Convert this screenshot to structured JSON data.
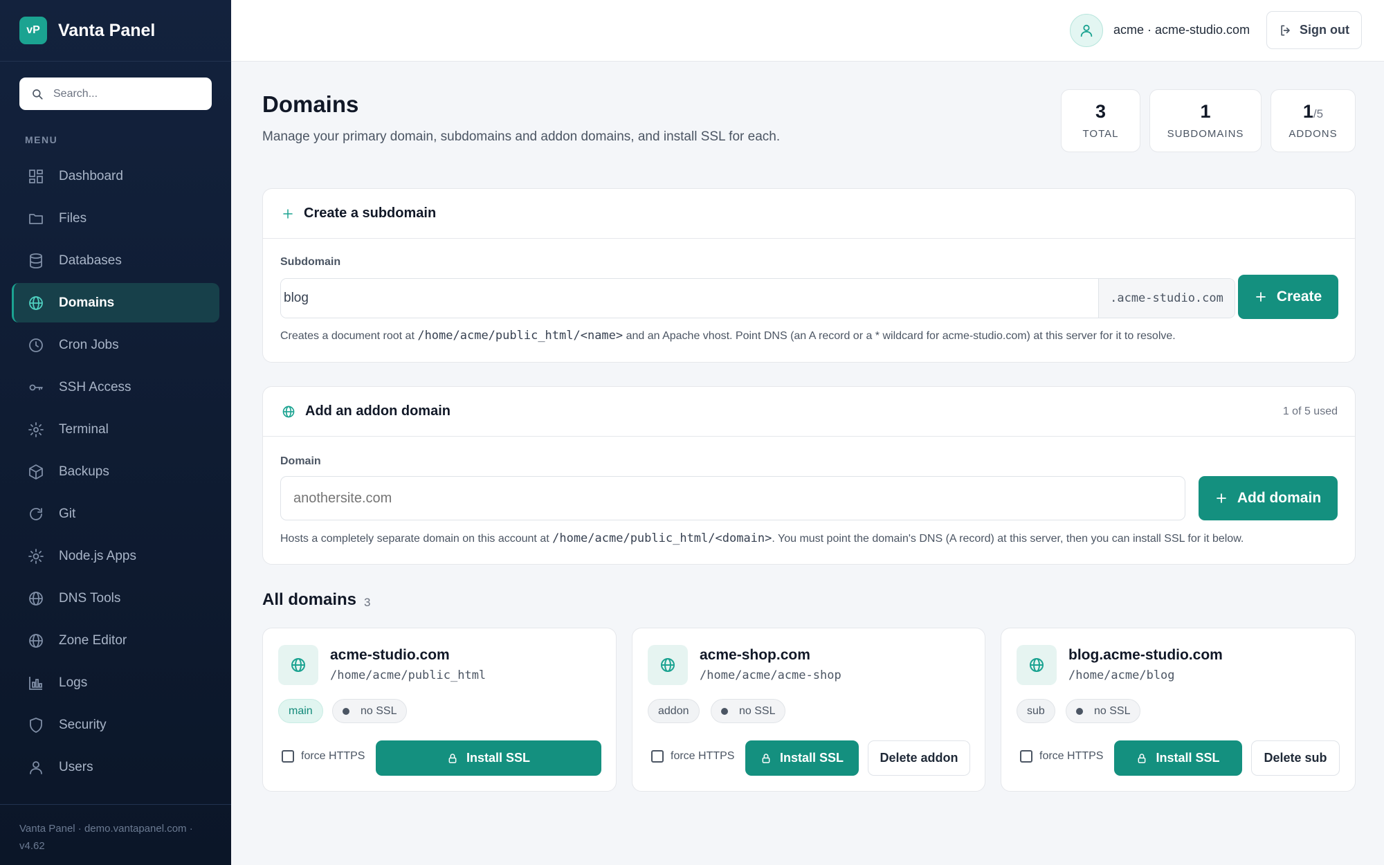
{
  "brand": {
    "logo_text": "vP",
    "name": "Vanta Panel"
  },
  "search": {
    "placeholder": "Search..."
  },
  "menu": {
    "heading": "MENU",
    "items": [
      {
        "label": "Dashboard",
        "icon": "dashboard-icon"
      },
      {
        "label": "Files",
        "icon": "folder-icon"
      },
      {
        "label": "Databases",
        "icon": "database-icon"
      },
      {
        "label": "Domains",
        "icon": "globe-icon",
        "active": true
      },
      {
        "label": "Cron Jobs",
        "icon": "clock-icon"
      },
      {
        "label": "SSH Access",
        "icon": "key-icon"
      },
      {
        "label": "Terminal",
        "icon": "terminal-icon"
      },
      {
        "label": "Backups",
        "icon": "box-icon"
      },
      {
        "label": "Git",
        "icon": "refresh-icon"
      },
      {
        "label": "Node.js Apps",
        "icon": "sun-icon"
      },
      {
        "label": "DNS Tools",
        "icon": "globe-icon"
      },
      {
        "label": "Zone Editor",
        "icon": "globe-icon"
      },
      {
        "label": "Logs",
        "icon": "bar-chart-icon"
      },
      {
        "label": "Security",
        "icon": "shield-icon"
      },
      {
        "label": "Users",
        "icon": "user-icon"
      }
    ]
  },
  "footer": {
    "text": "Vanta Panel · demo.vantapanel.com · v4.62"
  },
  "topbar": {
    "account": "acme · acme-studio.com",
    "signout_label": "Sign out"
  },
  "page": {
    "title": "Domains",
    "subtitle": "Manage your primary domain, subdomains and addon domains, and install SSL for each."
  },
  "stats": {
    "total": {
      "value": "3",
      "label": "TOTAL"
    },
    "subdomains": {
      "value": "1",
      "label": "SUBDOMAINS"
    },
    "addons": {
      "value": "1",
      "max": "/5",
      "label": "ADDONS"
    }
  },
  "create_subdomain": {
    "title": "Create a subdomain",
    "field_label": "Subdomain",
    "value": "blog",
    "suffix": ".acme-studio.com",
    "button_label": "Create",
    "help_before": "Creates a document root at ",
    "help_code": "/home/acme/public_html/<name>",
    "help_after": " and an Apache vhost. Point DNS (an A record or a * wildcard for acme-studio.com) at this server for it to resolve."
  },
  "addon_domain": {
    "title": "Add an addon domain",
    "usage": "1 of 5 used",
    "field_label": "Domain",
    "placeholder": "anothersite.com",
    "button_label": "Add domain",
    "help_before": "Hosts a completely separate domain on this account at ",
    "help_code": "/home/acme/public_html/<domain>",
    "help_after": ". You must point the domain's DNS (A record) at this server, then you can install SSL for it below."
  },
  "all_domains": {
    "title": "All domains",
    "count": "3",
    "force_label": "force HTTPS",
    "ssl_button": "Install SSL",
    "items": [
      {
        "name": "acme-studio.com",
        "path": "/home/acme/public_html",
        "type": "main",
        "ssl": "no SSL",
        "delete_label": ""
      },
      {
        "name": "acme-shop.com",
        "path": "/home/acme/acme-shop",
        "type": "addon",
        "ssl": "no SSL",
        "delete_label": "Delete addon"
      },
      {
        "name": "blog.acme-studio.com",
        "path": "/home/acme/blog",
        "type": "sub",
        "ssl": "no SSL",
        "delete_label": "Delete sub"
      }
    ]
  },
  "colors": {
    "accent": "#14907f",
    "sidebar": "#13223d",
    "background": "#f4f6f9"
  }
}
